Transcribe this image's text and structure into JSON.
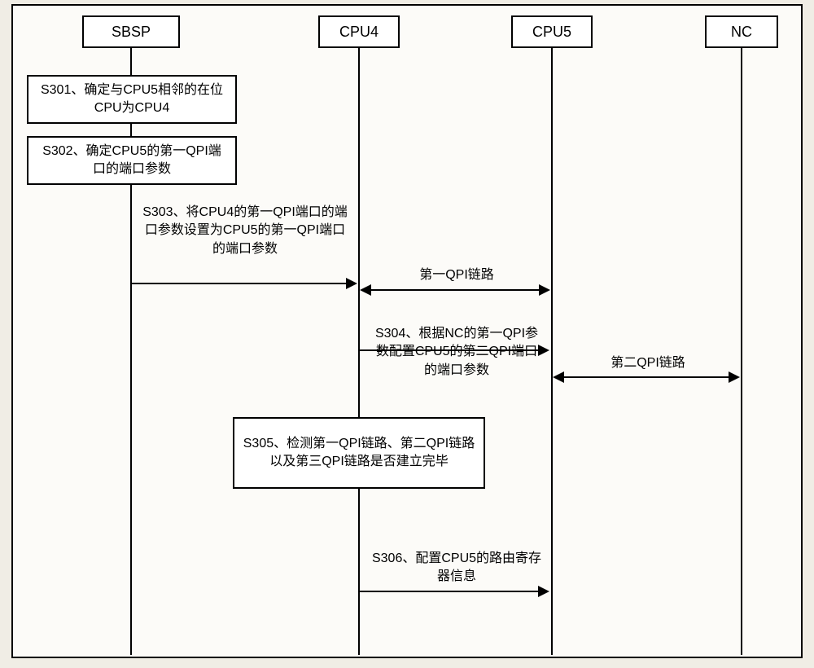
{
  "participants": {
    "p1": "SBSP",
    "p2": "CPU4",
    "p3": "CPU5",
    "p4": "NC"
  },
  "steps": {
    "s301": "S301、确定与CPU5相邻的在位CPU为CPU4",
    "s302": "S302、确定CPU5的第一QPI端口的端口参数",
    "s303": "S303、将CPU4的第一QPI端口的端口参数设置为CPU5的第一QPI端口的端口参数",
    "s304": "S304、根据NC的第一QPI参数配置CPU5的第二QPI端口的端口参数",
    "s305": "S305、检测第一QPI链路、第二QPI链路以及第三QPI链路是否建立完毕",
    "s306": "S306、配置CPU5的路由寄存器信息"
  },
  "links": {
    "qpi1": "第一QPI链路",
    "qpi2": "第二QPI链路"
  },
  "chart_data": {
    "type": "table",
    "description": "UML-style sequence diagram showing QPI link setup between SBSP, CPU4, CPU5, and NC",
    "participants": [
      "SBSP",
      "CPU4",
      "CPU5",
      "NC"
    ],
    "sequence": [
      {
        "id": "S301",
        "actor": "SBSP",
        "action": "self",
        "text": "确定与CPU5相邻的在位CPU为CPU4"
      },
      {
        "id": "S302",
        "actor": "SBSP",
        "action": "self",
        "text": "确定CPU5的第一QPI端口的端口参数"
      },
      {
        "id": "S303",
        "from": "SBSP",
        "to": "CPU4",
        "text": "将CPU4的第一QPI端口的端口参数设置为CPU5的第一QPI端口的端口参数"
      },
      {
        "id": "QPI1",
        "from": "CPU4",
        "to": "CPU5",
        "bidirectional": true,
        "text": "第一QPI链路"
      },
      {
        "id": "S304",
        "from": "CPU4",
        "to": "CPU5",
        "text": "根据NC的第一QPI参数配置CPU5的第二QPI端口的端口参数"
      },
      {
        "id": "QPI2",
        "from": "CPU5",
        "to": "NC",
        "bidirectional": true,
        "text": "第二QPI链路"
      },
      {
        "id": "S305",
        "actor": "CPU4",
        "action": "self",
        "text": "检测第一QPI链路、第二QPI链路以及第三QPI链路是否建立完毕"
      },
      {
        "id": "S306",
        "from": "CPU4",
        "to": "CPU5",
        "text": "配置CPU5的路由寄存器信息"
      }
    ]
  }
}
